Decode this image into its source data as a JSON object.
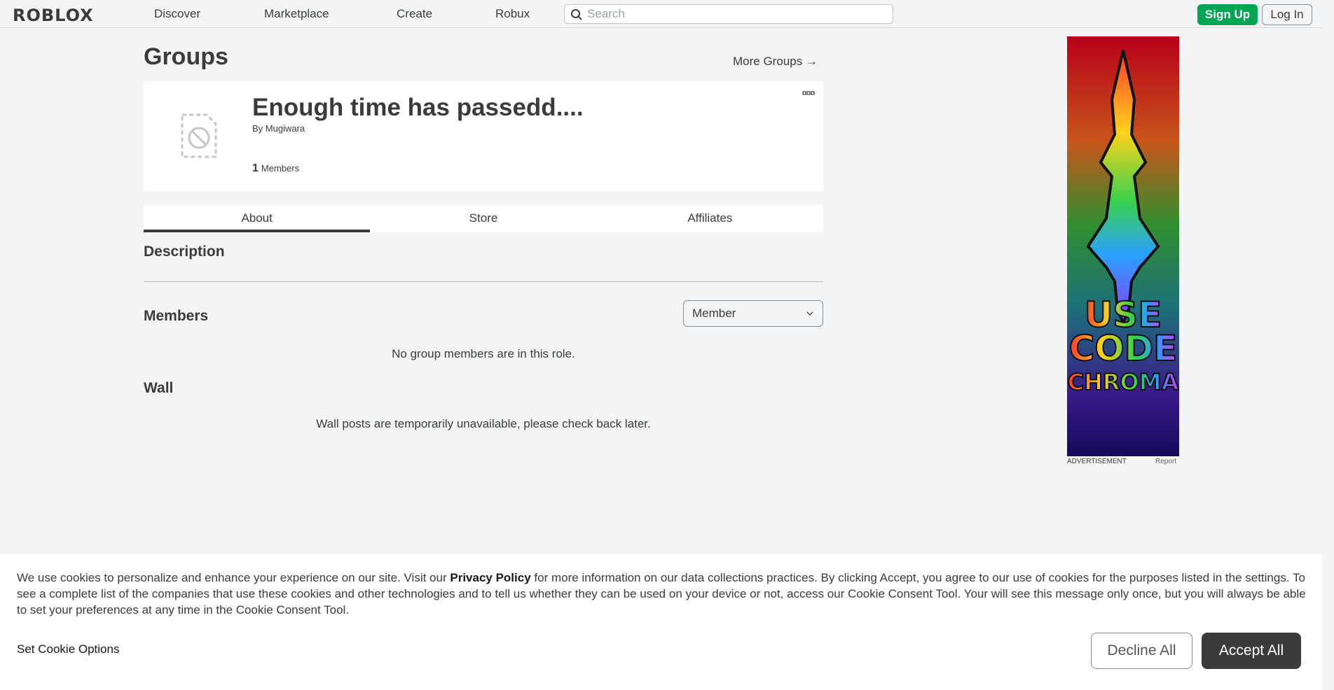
{
  "nav": {
    "logo": "ROBLOX",
    "links": [
      "Discover",
      "Marketplace",
      "Create",
      "Robux"
    ],
    "search_placeholder": "Search",
    "signup": "Sign Up",
    "login": "Log In"
  },
  "page": {
    "title": "Groups",
    "more_groups": "More Groups →"
  },
  "group": {
    "name": "Enough time has passedd....",
    "by_label": "By",
    "owner": "Mugiwara",
    "member_count": "1",
    "members_label": "Members"
  },
  "tabs": [
    {
      "label": "About",
      "active": true
    },
    {
      "label": "Store",
      "active": false
    },
    {
      "label": "Affiliates",
      "active": false
    }
  ],
  "sections": {
    "description": "Description",
    "members": "Members",
    "role_selected": "Member",
    "no_members": "No group members are in this role.",
    "wall": "Wall",
    "wall_unavailable": "Wall posts are temporarily unavailable, please check back later."
  },
  "ad": {
    "image_text_lines": [
      "USE",
      "CODE",
      "CHROMA"
    ],
    "label": "ADVERTISEMENT",
    "report": "Report"
  },
  "cookie": {
    "text_pre": "We use cookies to personalize and enhance your experience on our site. Visit our ",
    "privacy_link": "Privacy Policy",
    "text_post": " for more information on our data collections practices. By clicking Accept, you agree to our use of cookies for the purposes listed in the settings. To see a complete list of the companies that use these cookies and other technologies and to tell us whether they can be used on your device or not, access our Cookie Consent Tool. Your will see this message only once, but you will always be able to set your preferences at any time in the Cookie Consent Tool.",
    "set_options": "Set Cookie Options",
    "decline": "Decline All",
    "accept": "Accept All"
  },
  "colors": {
    "signup_green": "#00a651",
    "accept_dark": "#393b3d",
    "background": "#f2f4f5"
  }
}
